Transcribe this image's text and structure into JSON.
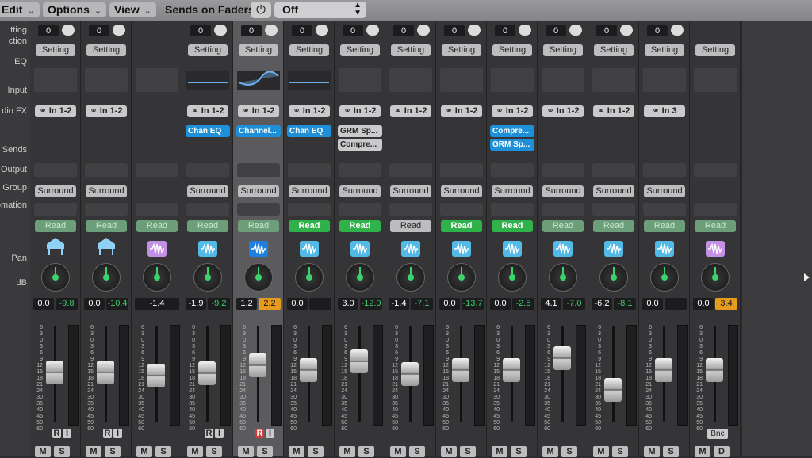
{
  "menubar": {
    "edit": "Edit",
    "options": "Options",
    "view": "View",
    "sends_label": "Sends on Faders:",
    "sends_value": "Off"
  },
  "row_labels": [
    "tting",
    "ction",
    "EQ",
    "Input",
    "dio FX",
    "Sends",
    "Output",
    "Group",
    "omation",
    "Pan",
    "dB"
  ],
  "strips": [
    {
      "num": "0",
      "setting": "Setting",
      "eq": false,
      "input": "In 1-2",
      "fx": [],
      "output": "Surround",
      "read": "Read",
      "read_style": "dim",
      "icon": "piano",
      "db": "0.0",
      "db2": "-9.8",
      "db2_style": "green",
      "fader": 0.45,
      "r_red": false,
      "ri": true,
      "ms": [
        "M",
        "S"
      ]
    },
    {
      "num": "0",
      "setting": "Setting",
      "eq": false,
      "input": "In 1-2",
      "fx": [],
      "output": "Surround",
      "read": "Read",
      "read_style": "dim",
      "icon": "piano",
      "db": "0.0",
      "db2": "-10.4",
      "db2_style": "green",
      "fader": 0.45,
      "r_red": false,
      "ri": true,
      "ms": [
        "M",
        "S"
      ]
    },
    {
      "num": "",
      "setting": "",
      "eq": false,
      "input": "",
      "fx": [],
      "output": "",
      "read": "Read",
      "read_style": "dim",
      "icon": "purple",
      "db": "",
      "db2": "-1.4",
      "db2_style": "white",
      "fader": 0.5,
      "r_red": false,
      "ri": false,
      "ms": [
        "M",
        "S"
      ]
    },
    {
      "num": "0",
      "setting": "Setting",
      "eq": true,
      "input": "In 1-2",
      "fx": [
        {
          "label": "Chan EQ",
          "style": "blue"
        }
      ],
      "output": "Surround",
      "read": "Read",
      "read_style": "dim",
      "icon": "cyan",
      "db": "-1.9",
      "db2": "-9.2",
      "db2_style": "green",
      "fader": 0.47,
      "r_red": false,
      "ri": true,
      "ms": [
        "M",
        "S"
      ]
    },
    {
      "num": "0",
      "setting": "Setting",
      "eq": true,
      "input": "In 1-2",
      "fx": [
        {
          "label": "Channel...",
          "style": "blue"
        }
      ],
      "output": "Surround",
      "read": "Read",
      "read_style": "dim",
      "icon": "blue",
      "db": "1.2",
      "db2": "2.2",
      "db2_style": "orange",
      "fader": 0.35,
      "r_red": true,
      "ri": true,
      "ms": [
        "M",
        "S"
      ]
    },
    {
      "num": "0",
      "setting": "Setting",
      "eq": true,
      "input": "In 1-2",
      "fx": [
        {
          "label": "Chan EQ",
          "style": "blue"
        }
      ],
      "output": "Surround",
      "read": "Read",
      "read_style": "on",
      "icon": "cyan",
      "db": "0.0",
      "db2": "",
      "db2_style": "empty",
      "fader": 0.42,
      "r_red": false,
      "ri": false,
      "ms": [
        "M",
        "S"
      ]
    },
    {
      "num": "0",
      "setting": "Setting",
      "eq": false,
      "input": "In 1-2",
      "fx": [
        {
          "label": "GRM Sp...",
          "style": "grey"
        },
        {
          "label": "Compre...",
          "style": "grey"
        }
      ],
      "output": "Surround",
      "read": "Read",
      "read_style": "on",
      "icon": "cyan",
      "db": "3.0",
      "db2": "-12.0",
      "db2_style": "green",
      "fader": 0.3,
      "r_red": false,
      "ri": false,
      "ms": [
        "M",
        "S"
      ]
    },
    {
      "num": "0",
      "setting": "Setting",
      "eq": false,
      "input": "In 1-2",
      "fx": [],
      "output": "Surround",
      "read": "Read",
      "read_style": "plain",
      "icon": "cyan",
      "db": "-1.4",
      "db2": "-7.1",
      "db2_style": "green",
      "fader": 0.48,
      "r_red": false,
      "ri": false,
      "ms": [
        "M",
        "S"
      ]
    },
    {
      "num": "0",
      "setting": "Setting",
      "eq": false,
      "input": "In 1-2",
      "fx": [],
      "output": "Surround",
      "read": "Read",
      "read_style": "on",
      "icon": "cyan",
      "db": "0.0",
      "db2": "-13.7",
      "db2_style": "green",
      "fader": 0.42,
      "r_red": false,
      "ri": false,
      "ms": [
        "M",
        "S"
      ]
    },
    {
      "num": "0",
      "setting": "Setting",
      "eq": false,
      "input": "In 1-2",
      "fx": [
        {
          "label": "Compre...",
          "style": "blue"
        },
        {
          "label": "GRM Sp...",
          "style": "blue"
        }
      ],
      "output": "Surround",
      "read": "Read",
      "read_style": "on",
      "icon": "cyan",
      "db": "0.0",
      "db2": "-2.5",
      "db2_style": "green",
      "fader": 0.42,
      "r_red": false,
      "ri": false,
      "ms": [
        "M",
        "S"
      ]
    },
    {
      "num": "0",
      "setting": "Setting",
      "eq": false,
      "input": "In 1-2",
      "fx": [],
      "output": "Surround",
      "read": "Read",
      "read_style": "dim",
      "icon": "cyan",
      "db": "4.1",
      "db2": "-7.0",
      "db2_style": "green",
      "fader": 0.25,
      "r_red": false,
      "ri": false,
      "ms": [
        "M",
        "S"
      ]
    },
    {
      "num": "0",
      "setting": "Setting",
      "eq": false,
      "input": "In 1-2",
      "fx": [],
      "output": "Surround",
      "read": "Read",
      "read_style": "dim",
      "icon": "cyan",
      "db": "-6.2",
      "db2": "-8.1",
      "db2_style": "green",
      "fader": 0.7,
      "r_red": false,
      "ri": false,
      "ms": [
        "M",
        "S"
      ]
    },
    {
      "num": "0",
      "setting": "Setting",
      "eq": false,
      "input": "In 3",
      "fx": [],
      "output": "Surround",
      "read": "Read",
      "read_style": "dim",
      "icon": "cyan",
      "db": "0.0",
      "db2": "",
      "db2_style": "empty",
      "fader": 0.42,
      "r_red": false,
      "ri": false,
      "ms": [
        "M",
        "S"
      ]
    },
    {
      "num": "",
      "setting": "Setting",
      "eq": false,
      "input": "",
      "fx": [],
      "output": "",
      "read": "Read",
      "read_style": "dim",
      "icon": "purple",
      "db": "0.0",
      "db2": "3.4",
      "db2_style": "orange",
      "fader": 0.42,
      "r_red": false,
      "ri": false,
      "ms": [
        "M",
        "D"
      ],
      "bnc": "Bnc"
    }
  ],
  "scale_ticks": [
    "6",
    "3",
    "0",
    "3",
    "6",
    "9",
    "12",
    "15",
    "18",
    "21",
    "24",
    "30",
    "35",
    "40",
    "45",
    "50",
    "60"
  ],
  "colors": {
    "read_on": "#2fb24a",
    "fx_blue": "#1f8fd8",
    "db_green": "#3dd36b",
    "db_orange": "#e69a1e"
  }
}
